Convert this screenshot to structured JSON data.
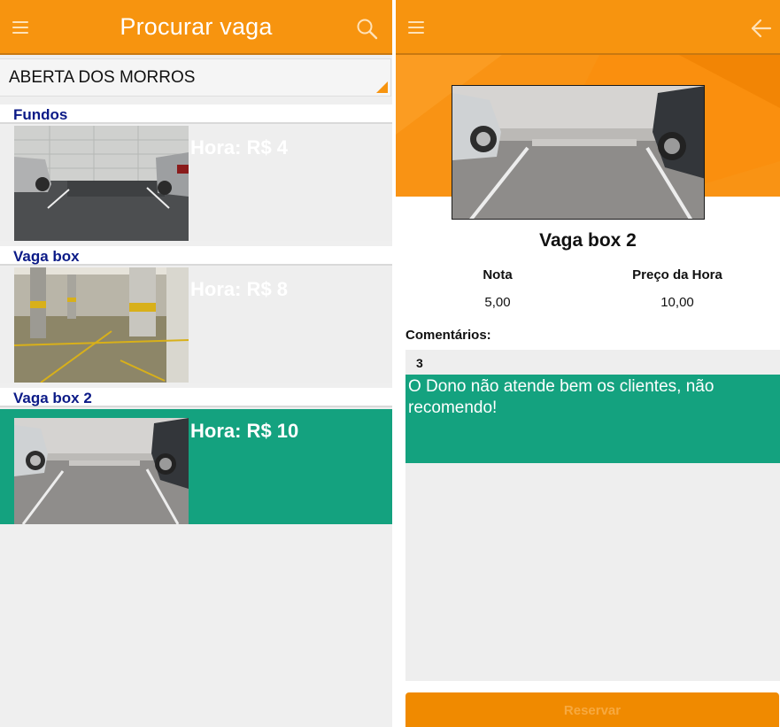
{
  "search_screen": {
    "title": "Procurar vaga",
    "dropdown": {
      "selected": "ABERTA DOS MORROS"
    },
    "items": [
      {
        "name": "Fundos",
        "price": "Hora: R$ 4",
        "selected": false
      },
      {
        "name": "Vaga box",
        "price": "Hora: R$ 8",
        "selected": false
      },
      {
        "name": "Vaga box 2",
        "price": "Hora: R$ 10",
        "selected": true
      }
    ]
  },
  "detail_screen": {
    "name": "Vaga box 2",
    "rating_label": "Nota",
    "rating_value": "5,00",
    "price_label": "Preço da Hora",
    "price_value": "10,00",
    "comments_label": "Comentários:",
    "comments": [
      {
        "rating": "3",
        "text": "O Dono não atende bem os clientes, não recomendo!"
      }
    ],
    "reserve_label": "Reservar"
  },
  "icons": {
    "menu": "hamburger-menu-icon",
    "search": "search-icon",
    "back": "back-arrow-icon",
    "dropdown": "dropdown-triangle-icon"
  },
  "colors": {
    "primary": "#f7940f",
    "accent_green": "#14a27f",
    "title_blue": "#0b1a87",
    "background": "#efefef"
  }
}
